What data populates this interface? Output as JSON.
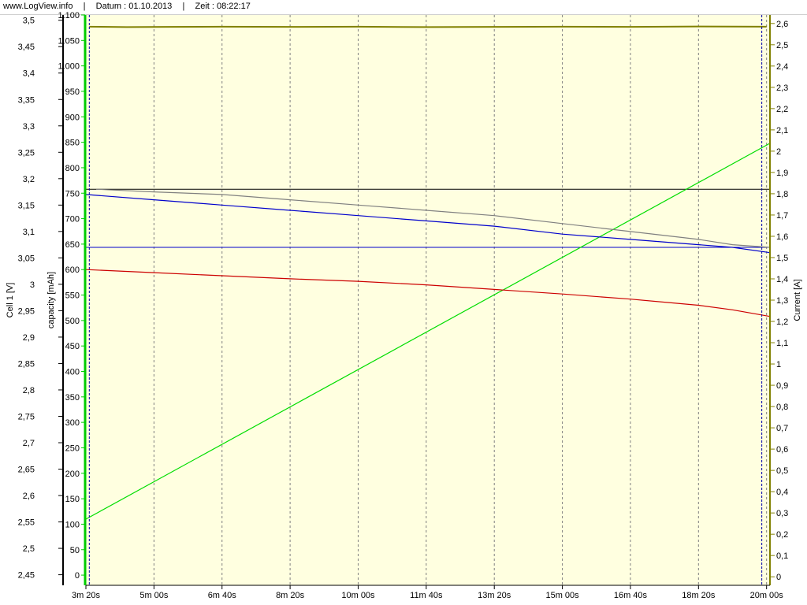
{
  "header": {
    "site": "www.LogView.info",
    "sep1": "|",
    "date_label": "Datum : 01.10.2013",
    "sep2": "|",
    "time_label": "Zeit : 08:22:17"
  },
  "colors": {
    "plot_bg": "#ffffe0",
    "voltage_axis": "#000000",
    "capacity_axis": "#00cc00",
    "current_axis": "#808000",
    "grid": "#808080",
    "series_current": "#808000",
    "series_capacity": "#00dd00",
    "series_gray": "#808080",
    "series_blue": "#0000cc",
    "series_red": "#cc0000",
    "ref_black": "#000000",
    "ref_blue": "#0000cc"
  },
  "chart_data": {
    "type": "line",
    "x_unit": "seconds",
    "xlim": [
      200,
      1205
    ],
    "x_ticks": [
      200,
      300,
      400,
      500,
      600,
      700,
      800,
      900,
      1000,
      1100,
      1200
    ],
    "x_tick_labels": [
      "3m 20s",
      "5m 00s",
      "6m 40s",
      "8m 20s",
      "10m 00s",
      "11m 40s",
      "13m 20s",
      "15m 00s",
      "16m 40s",
      "18m 20s",
      "20m 00s"
    ],
    "y_left1": {
      "label": "Cell 1 [V]",
      "ylim": [
        2.43,
        3.51
      ],
      "ticks": [
        2.45,
        2.5,
        2.55,
        2.6,
        2.65,
        2.7,
        2.75,
        2.8,
        2.85,
        2.9,
        2.95,
        3.0,
        3.05,
        3.1,
        3.15,
        3.2,
        3.25,
        3.3,
        3.35,
        3.4,
        3.45,
        3.5
      ],
      "tick_labels": [
        "2,45",
        "2,5",
        "2,55",
        "2,6",
        "2,65",
        "2,7",
        "2,75",
        "2,8",
        "2,85",
        "2,9",
        "2,95",
        "3",
        "3,05",
        "3,1",
        "3,15",
        "3,2",
        "3,25",
        "3,3",
        "3,35",
        "3,4",
        "3,45",
        "3,5"
      ]
    },
    "y_left2": {
      "label": "capacity [mAh]",
      "ylim": [
        -20,
        1100
      ],
      "ticks": [
        0,
        50,
        100,
        150,
        200,
        250,
        300,
        350,
        400,
        450,
        500,
        550,
        600,
        650,
        700,
        750,
        800,
        850,
        900,
        950,
        1000,
        1050,
        1100
      ],
      "tick_labels": [
        "0",
        "50",
        "100",
        "150",
        "200",
        "250",
        "300",
        "350",
        "400",
        "450",
        "500",
        "550",
        "600",
        "650",
        "700",
        "750",
        "800",
        "850",
        "900",
        "950",
        "1.000",
        "1.050",
        "1.100"
      ]
    },
    "y_right": {
      "label": "Current [A]",
      "ylim": [
        -0.04,
        2.64
      ],
      "ticks": [
        0,
        0.1,
        0.2,
        0.3,
        0.4,
        0.5,
        0.6,
        0.7,
        0.8,
        0.9,
        1.0,
        1.1,
        1.2,
        1.3,
        1.4,
        1.5,
        1.6,
        1.7,
        1.8,
        1.9,
        2.0,
        2.1,
        2.2,
        2.3,
        2.4,
        2.5,
        2.6
      ],
      "tick_labels": [
        "0",
        "0,1",
        "0,2",
        "0,3",
        "0,4",
        "0,5",
        "0,6",
        "0,7",
        "0,8",
        "0,9",
        "1",
        "1,1",
        "1,2",
        "1,3",
        "1,4",
        "1,5",
        "1,6",
        "1,7",
        "1,8",
        "1,9",
        "2",
        "2,1",
        "2,2",
        "2,3",
        "2,4",
        "2,5",
        "2,6"
      ]
    },
    "cursors_x": [
      205,
      1193
    ],
    "grid": true,
    "reference_lines": [
      {
        "axis": "y_left1",
        "value": 3.18,
        "color_key": "ref_black"
      },
      {
        "axis": "y_left1",
        "value": 3.07,
        "color_key": "ref_blue"
      }
    ],
    "series": [
      {
        "axis": "y_right",
        "color_key": "series_current",
        "x": [
          205,
          260,
          320,
          400,
          500,
          600,
          700,
          800,
          900,
          1000,
          1100,
          1200
        ],
        "y": [
          2.585,
          2.583,
          2.584,
          2.585,
          2.584,
          2.585,
          2.583,
          2.584,
          2.585,
          2.584,
          2.586,
          2.585
        ]
      },
      {
        "axis": "y_left2",
        "color_key": "series_capacity",
        "x": [
          200,
          1205
        ],
        "y": [
          110,
          848
        ]
      },
      {
        "axis": "y_left1",
        "color_key": "series_gray",
        "x": [
          215,
          300,
          400,
          500,
          600,
          700,
          800,
          900,
          1000,
          1100,
          1150,
          1205
        ],
        "y": [
          3.18,
          3.175,
          3.17,
          3.16,
          3.15,
          3.14,
          3.13,
          3.115,
          3.1,
          3.085,
          3.075,
          3.07
        ]
      },
      {
        "axis": "y_left1",
        "color_key": "series_blue",
        "x": [
          200,
          300,
          400,
          500,
          600,
          700,
          800,
          900,
          1000,
          1100,
          1150,
          1205
        ],
        "y": [
          3.17,
          3.16,
          3.15,
          3.14,
          3.13,
          3.12,
          3.11,
          3.095,
          3.085,
          3.075,
          3.07,
          3.06
        ]
      },
      {
        "axis": "y_left2",
        "color_key": "series_red",
        "x": [
          200,
          300,
          400,
          500,
          600,
          700,
          800,
          900,
          1000,
          1100,
          1150,
          1205
        ],
        "y": [
          600,
          594,
          588,
          582,
          577,
          570,
          561,
          552,
          542,
          530,
          521,
          508
        ]
      }
    ]
  }
}
